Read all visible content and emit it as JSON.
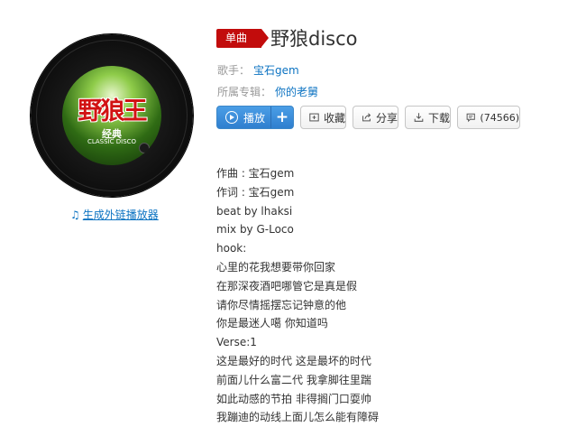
{
  "left": {
    "cover": {
      "title": "野狼王",
      "subtitle": "经典",
      "subtitle2": "CLASSIC DISCO"
    },
    "player_link": "生成外链播放器"
  },
  "song": {
    "badge": "单曲",
    "title": "野狼disco",
    "singer_label": "歌手：",
    "singer": "宝石gem",
    "album_label": "所属专辑：",
    "album": "你的老舅"
  },
  "actions": {
    "play": "播放",
    "add": "+",
    "collect": "收藏",
    "share": "分享",
    "download": "下载",
    "comment_count": "(74566)"
  },
  "lyrics": [
    "作曲 : 宝石gem",
    "作词 : 宝石gem",
    "beat by lhaksi",
    "mix by G-Loco",
    "hook:",
    "心里的花我想要带你回家",
    "在那深夜酒吧哪管它是真是假",
    "请你尽情摇摆忘记钟意的他",
    "你是最迷人噶 你知道吗",
    "Verse:1",
    "这是最好的时代 这是最坏的时代",
    "前面儿什么富二代 我拿脚往里踹",
    "如此动感的节拍 非得搁门口耍帅",
    "我蹦迪的动线上面儿怎么能有障碍"
  ],
  "colors": {
    "accent_red": "#c20c0c",
    "link_blue": "#0c73c2",
    "play_blue": "#2f7fcf"
  },
  "icons": [
    "music-note-icon",
    "play-circle-icon",
    "collect-icon",
    "share-icon",
    "download-icon",
    "comment-icon"
  ]
}
